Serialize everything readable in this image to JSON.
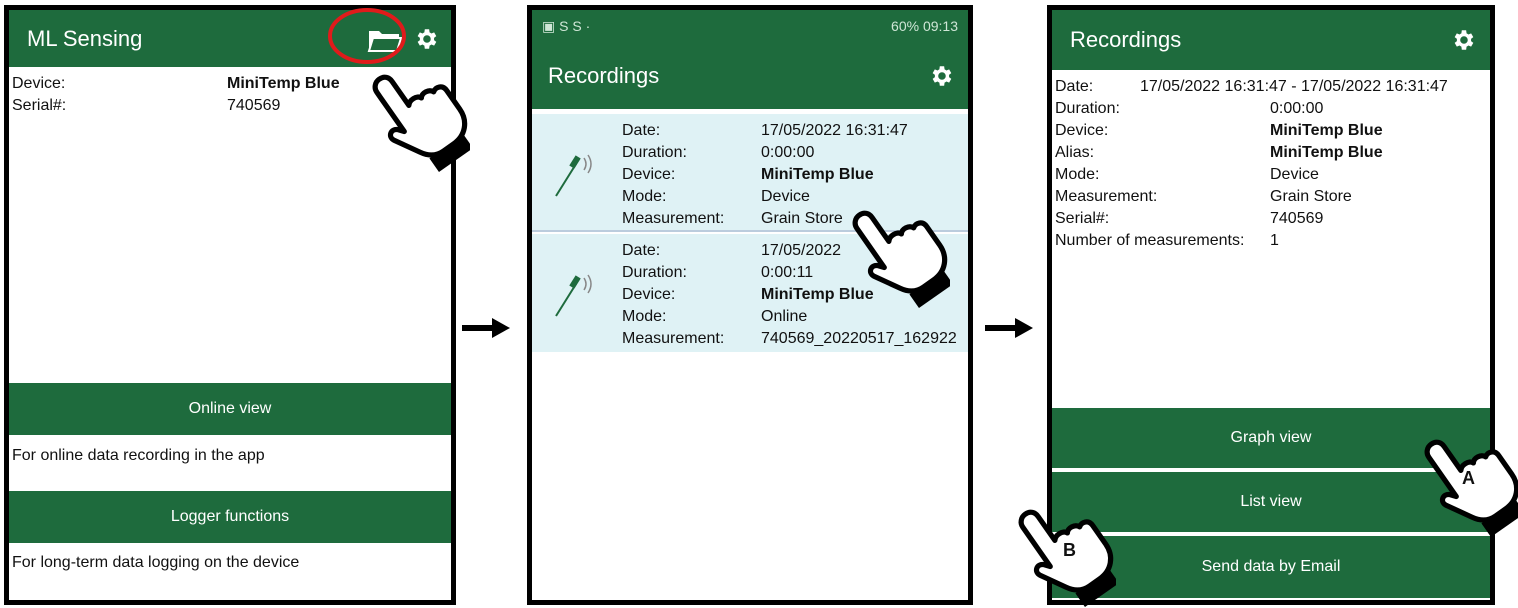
{
  "screen1": {
    "title": "ML Sensing",
    "device_label": "Device:",
    "device_value": "MiniTemp Blue",
    "serial_label": "Serial#:",
    "serial_value": "740569",
    "online_view_button": "Online view",
    "online_view_desc": "For online data recording in the app",
    "logger_button": "Logger functions",
    "logger_desc": "For long-term data logging on the device",
    "icons": [
      "folder-icon",
      "gear-icon",
      "pointing-hand-icon"
    ]
  },
  "screen2": {
    "status_bar": {
      "left": "▣ S S ·",
      "right": "60% 09:13"
    },
    "title": "Recordings",
    "recordings": [
      {
        "date_label": "Date:",
        "date": "17/05/2022 16:31:47",
        "duration_label": "Duration:",
        "duration": "0:00:00",
        "device_label": "Device:",
        "device": "MiniTemp Blue",
        "mode_label": "Mode:",
        "mode": "Device",
        "measurement_label": "Measurement:",
        "measurement": "Grain Store"
      },
      {
        "date_label": "Date:",
        "date": "17/05/2022",
        "duration_label": "Duration:",
        "duration": "0:00:11",
        "device_label": "Device:",
        "device": "MiniTemp Blue",
        "mode_label": "Mode:",
        "mode": "Online",
        "measurement_label": "Measurement:",
        "measurement": "740569_20220517_162922"
      }
    ]
  },
  "screen3": {
    "title": "Recordings",
    "date_label": "Date:",
    "date_value": "17/05/2022 16:31:47 - 17/05/2022 16:31:47",
    "details": [
      {
        "label": "Duration:",
        "value": "0:00:00",
        "bold": false
      },
      {
        "label": "Device:",
        "value": "MiniTemp Blue",
        "bold": true
      },
      {
        "label": "Alias:",
        "value": "MiniTemp Blue",
        "bold": true
      },
      {
        "label": "Mode:",
        "value": "Device",
        "bold": false
      },
      {
        "label": "Measurement:",
        "value": "Grain Store",
        "bold": false
      },
      {
        "label": "Serial#:",
        "value": "740569",
        "bold": false
      },
      {
        "label": "Number of measurements:",
        "value": "1",
        "bold": false
      }
    ],
    "graph_button": "Graph view",
    "list_button": "List view",
    "email_button": "Send data by Email",
    "hand_a_label": "A",
    "hand_b_label": "B"
  },
  "colors": {
    "app_green": "#1e6b3d",
    "list_bg": "#dff2f5",
    "highlight_circle": "#e01b1b"
  }
}
